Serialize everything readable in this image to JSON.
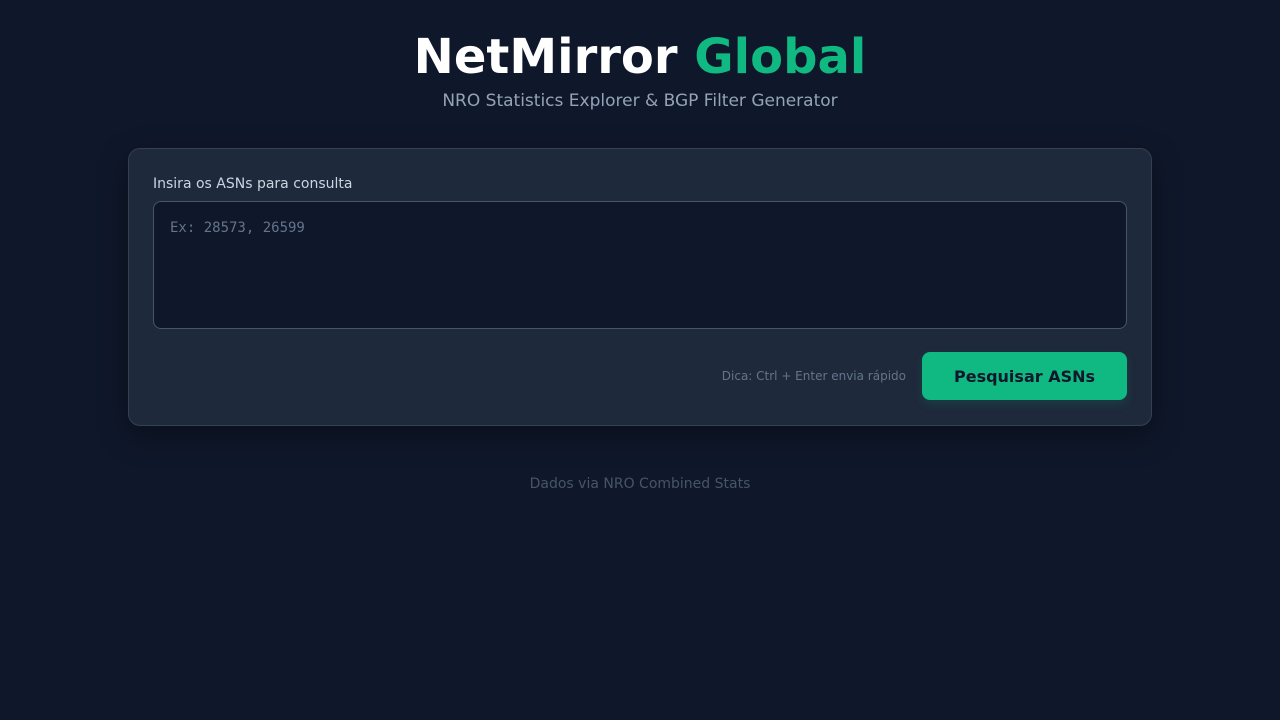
{
  "header": {
    "title_main": "NetMirror",
    "title_accent": "Global",
    "subtitle": "NRO Statistics Explorer & BGP Filter Generator"
  },
  "search": {
    "label": "Insira os ASNs para consulta",
    "value": "",
    "placeholder": "Ex: 28573, 26599",
    "hint": "Dica: Ctrl + Enter envia rápido",
    "button_label": "Pesquisar ASNs"
  },
  "footer": {
    "text": "Dados via NRO Combined Stats"
  },
  "colors": {
    "background": "#0f172a",
    "card": "#1e293b",
    "accent": "#10b981"
  }
}
